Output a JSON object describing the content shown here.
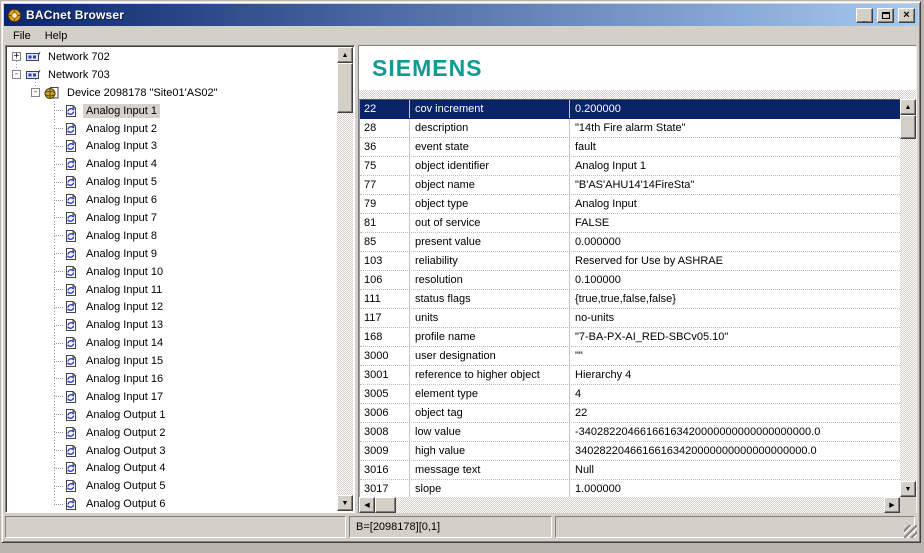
{
  "window": {
    "title": "BACnet Browser",
    "icons": {
      "minimize": "_",
      "maximize": "maximize-box",
      "close": "×",
      "scroll_up": "▲",
      "scroll_down": "▼",
      "scroll_left": "◀",
      "scroll_right": "▶"
    }
  },
  "colors": {
    "selection": "#0a246a",
    "title_gradient_start": "#0b256d",
    "title_gradient_end": "#a7caf0",
    "brand_teal": "#0f9a94"
  },
  "menu": {
    "items": [
      "File",
      "Help"
    ]
  },
  "tree": {
    "items": [
      {
        "label": "Network 702",
        "level": 0,
        "expand": "plus",
        "icon": "network",
        "selected": false
      },
      {
        "label": "Network 703",
        "level": 0,
        "expand": "minus",
        "icon": "network",
        "selected": false
      },
      {
        "label": "Device 2098178 \"Site01'AS02\"",
        "level": 1,
        "expand": "minus",
        "icon": "device",
        "selected": false
      },
      {
        "label": "Analog Input 1",
        "level": 2,
        "expand": null,
        "icon": "object",
        "selected": true
      },
      {
        "label": "Analog Input 2",
        "level": 2,
        "expand": null,
        "icon": "object",
        "selected": false
      },
      {
        "label": "Analog Input 3",
        "level": 2,
        "expand": null,
        "icon": "object",
        "selected": false
      },
      {
        "label": "Analog Input 4",
        "level": 2,
        "expand": null,
        "icon": "object",
        "selected": false
      },
      {
        "label": "Analog Input 5",
        "level": 2,
        "expand": null,
        "icon": "object",
        "selected": false
      },
      {
        "label": "Analog Input 6",
        "level": 2,
        "expand": null,
        "icon": "object",
        "selected": false
      },
      {
        "label": "Analog Input 7",
        "level": 2,
        "expand": null,
        "icon": "object",
        "selected": false
      },
      {
        "label": "Analog Input 8",
        "level": 2,
        "expand": null,
        "icon": "object",
        "selected": false
      },
      {
        "label": "Analog Input 9",
        "level": 2,
        "expand": null,
        "icon": "object",
        "selected": false
      },
      {
        "label": "Analog Input 10",
        "level": 2,
        "expand": null,
        "icon": "object",
        "selected": false
      },
      {
        "label": "Analog Input 11",
        "level": 2,
        "expand": null,
        "icon": "object",
        "selected": false
      },
      {
        "label": "Analog Input 12",
        "level": 2,
        "expand": null,
        "icon": "object",
        "selected": false
      },
      {
        "label": "Analog Input 13",
        "level": 2,
        "expand": null,
        "icon": "object",
        "selected": false
      },
      {
        "label": "Analog Input 14",
        "level": 2,
        "expand": null,
        "icon": "object",
        "selected": false
      },
      {
        "label": "Analog Input 15",
        "level": 2,
        "expand": null,
        "icon": "object",
        "selected": false
      },
      {
        "label": "Analog Input 16",
        "level": 2,
        "expand": null,
        "icon": "object",
        "selected": false
      },
      {
        "label": "Analog Input 17",
        "level": 2,
        "expand": null,
        "icon": "object",
        "selected": false
      },
      {
        "label": "Analog Output 1",
        "level": 2,
        "expand": null,
        "icon": "object",
        "selected": false
      },
      {
        "label": "Analog Output 2",
        "level": 2,
        "expand": null,
        "icon": "object",
        "selected": false
      },
      {
        "label": "Analog Output 3",
        "level": 2,
        "expand": null,
        "icon": "object",
        "selected": false
      },
      {
        "label": "Analog Output 4",
        "level": 2,
        "expand": null,
        "icon": "object",
        "selected": false
      },
      {
        "label": "Analog Output 5",
        "level": 2,
        "expand": null,
        "icon": "object",
        "selected": false
      },
      {
        "label": "Analog Output 6",
        "level": 2,
        "expand": null,
        "icon": "object",
        "selected": false
      }
    ]
  },
  "brand": {
    "logo": "SIEMENS"
  },
  "table": {
    "selected_index": 0,
    "rows": [
      [
        "22",
        "cov increment",
        "0.200000"
      ],
      [
        "28",
        "description",
        "\"14th Fire alarm State\""
      ],
      [
        "36",
        "event state",
        "fault"
      ],
      [
        "75",
        "object identifier",
        "Analog Input 1"
      ],
      [
        "77",
        "object name",
        "\"B'AS'AHU14'14FireSta\""
      ],
      [
        "79",
        "object type",
        "Analog Input"
      ],
      [
        "81",
        "out of service",
        "FALSE"
      ],
      [
        "85",
        "present value",
        "0.000000"
      ],
      [
        "103",
        "reliability",
        "Reserved for Use by ASHRAE"
      ],
      [
        "106",
        "resolution",
        "0.100000"
      ],
      [
        "111",
        "status flags",
        "{true,true,false,false}"
      ],
      [
        "117",
        "units",
        "no-units"
      ],
      [
        "168",
        "profile name",
        "\"7-BA-PX-AI_RED-SBCv05.10\""
      ],
      [
        "3000",
        "user designation",
        "\"\""
      ],
      [
        "3001",
        "reference to higher object",
        "Hierarchy 4"
      ],
      [
        "3005",
        "element type",
        "4"
      ],
      [
        "3006",
        "object tag",
        "22"
      ],
      [
        "3008",
        "low value",
        "-34028220466166163420000000000000000000.0"
      ],
      [
        "3009",
        "high value",
        "34028220466166163420000000000000000000.0"
      ],
      [
        "3016",
        "message text",
        "Null"
      ],
      [
        "3017",
        "slope",
        "1.000000"
      ]
    ]
  },
  "status": {
    "left": "",
    "center": "B=[2098178][0,1]",
    "right": ""
  }
}
